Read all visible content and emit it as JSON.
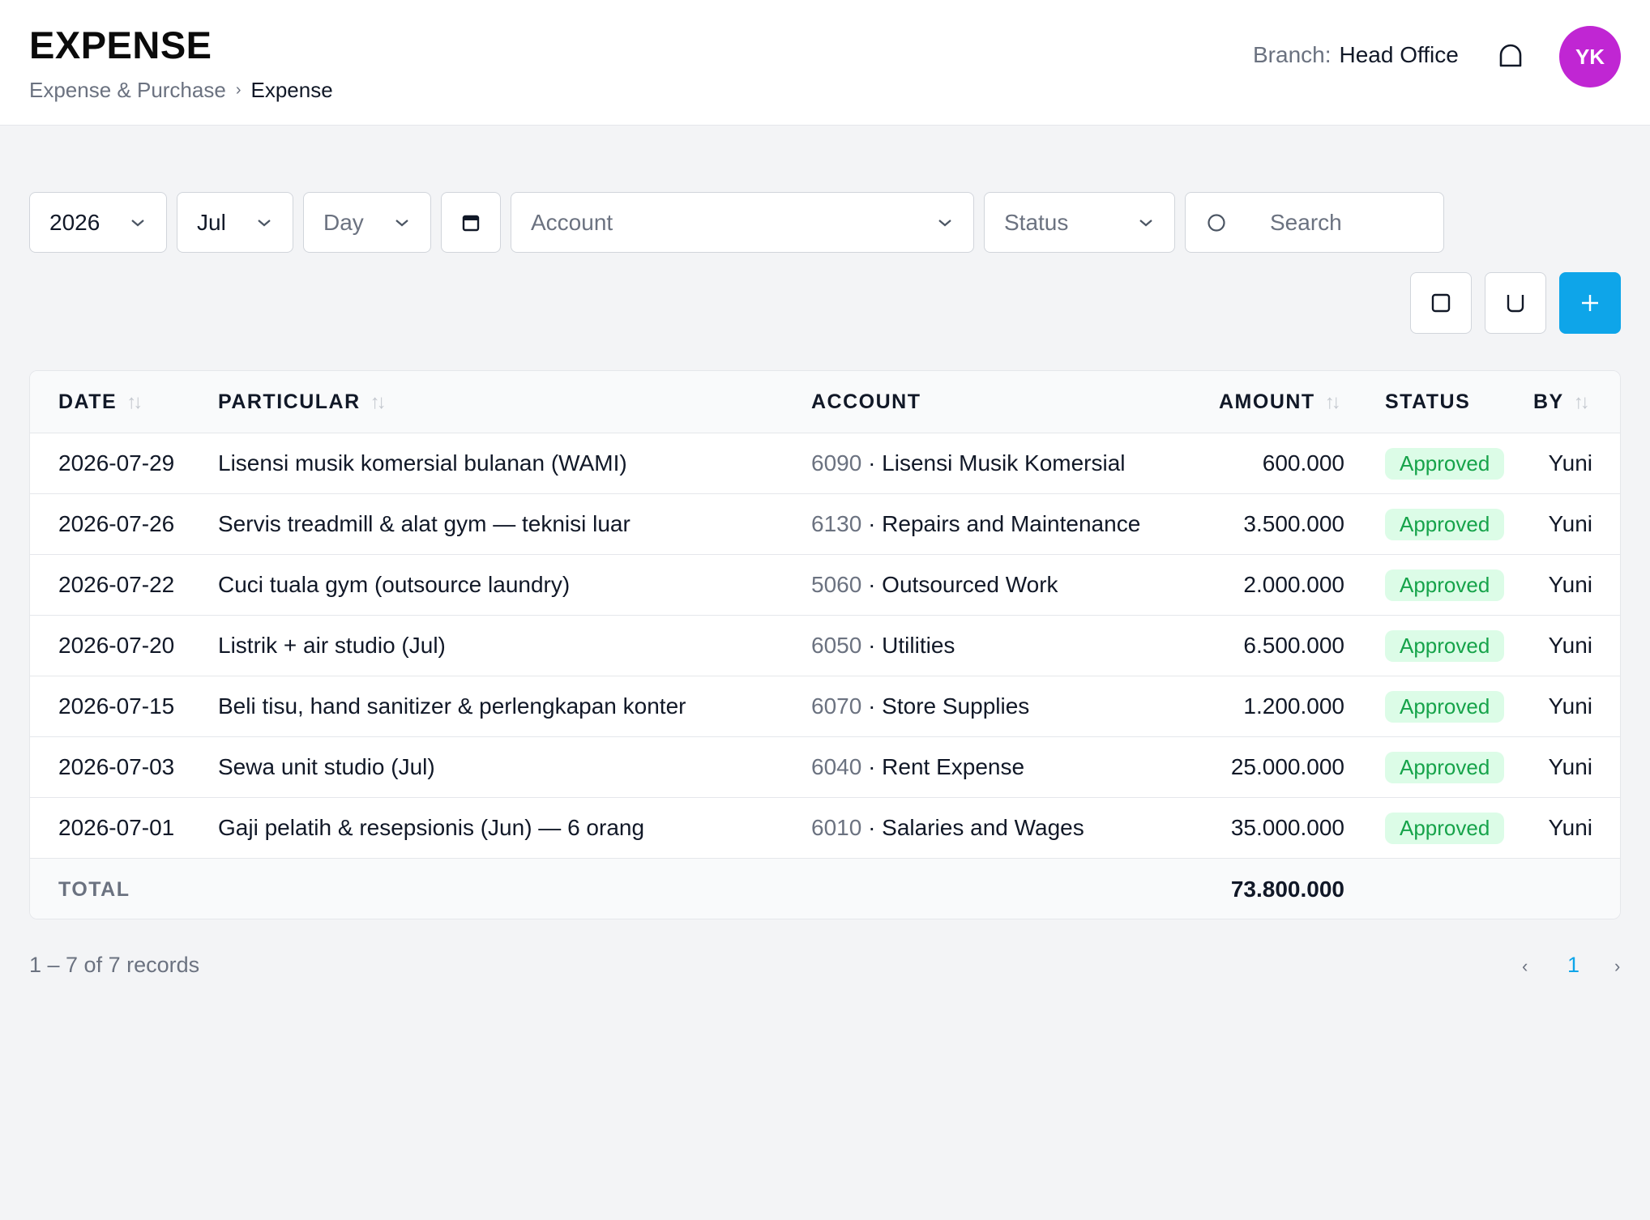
{
  "header": {
    "title": "EXPENSE",
    "breadcrumb": {
      "parent": "Expense & Purchase",
      "separator": "›",
      "current": "Expense"
    },
    "branch_label": "Branch:",
    "branch_value": "Head Office",
    "avatar_initials": "YK",
    "avatar_color": "#c026d3"
  },
  "filters": {
    "year": "2026",
    "month": "Jul",
    "day_placeholder": "Day",
    "account_placeholder": "Account",
    "status_placeholder": "Status",
    "search_placeholder": "Search"
  },
  "actions": {
    "add_button_color": "#0ea5e9",
    "icons": [
      "square-icon",
      "u-icon",
      "plus-icon"
    ]
  },
  "table": {
    "columns": {
      "date": "DATE",
      "particular": "PARTICULAR",
      "account": "ACCOUNT",
      "amount": "AMOUNT",
      "status": "STATUS",
      "by": "BY"
    },
    "rows": [
      {
        "date": "2026-07-29",
        "particular": "Lisensi musik komersial bulanan (WAMI)",
        "account_code": "6090",
        "account_name": "· Lisensi Musik Komersial",
        "amount": "600.000",
        "status": "Approved",
        "by": "Yuni"
      },
      {
        "date": "2026-07-26",
        "particular": "Servis treadmill & alat gym — teknisi luar",
        "account_code": "6130",
        "account_name": "· Repairs and Maintenance",
        "amount": "3.500.000",
        "status": "Approved",
        "by": "Yuni"
      },
      {
        "date": "2026-07-22",
        "particular": "Cuci tuala gym (outsource laundry)",
        "account_code": "5060",
        "account_name": "· Outsourced Work",
        "amount": "2.000.000",
        "status": "Approved",
        "by": "Yuni"
      },
      {
        "date": "2026-07-20",
        "particular": "Listrik + air studio (Jul)",
        "account_code": "6050",
        "account_name": "· Utilities",
        "amount": "6.500.000",
        "status": "Approved",
        "by": "Yuni"
      },
      {
        "date": "2026-07-15",
        "particular": "Beli tisu, hand sanitizer & perlengkapan konter",
        "account_code": "6070",
        "account_name": "· Store Supplies",
        "amount": "1.200.000",
        "status": "Approved",
        "by": "Yuni"
      },
      {
        "date": "2026-07-03",
        "particular": "Sewa unit studio (Jul)",
        "account_code": "6040",
        "account_name": "· Rent Expense",
        "amount": "25.000.000",
        "status": "Approved",
        "by": "Yuni"
      },
      {
        "date": "2026-07-01",
        "particular": "Gaji pelatih & resepsionis (Jun) — 6 orang",
        "account_code": "6010",
        "account_name": "· Salaries and Wages",
        "amount": "35.000.000",
        "status": "Approved",
        "by": "Yuni"
      }
    ],
    "total_label": "TOTAL",
    "total_amount": "73.800.000",
    "status_color": "#16a34a"
  },
  "footer": {
    "records_text": "1 – 7 of 7 records",
    "prev": "‹",
    "current_page": "1",
    "next": "›"
  }
}
